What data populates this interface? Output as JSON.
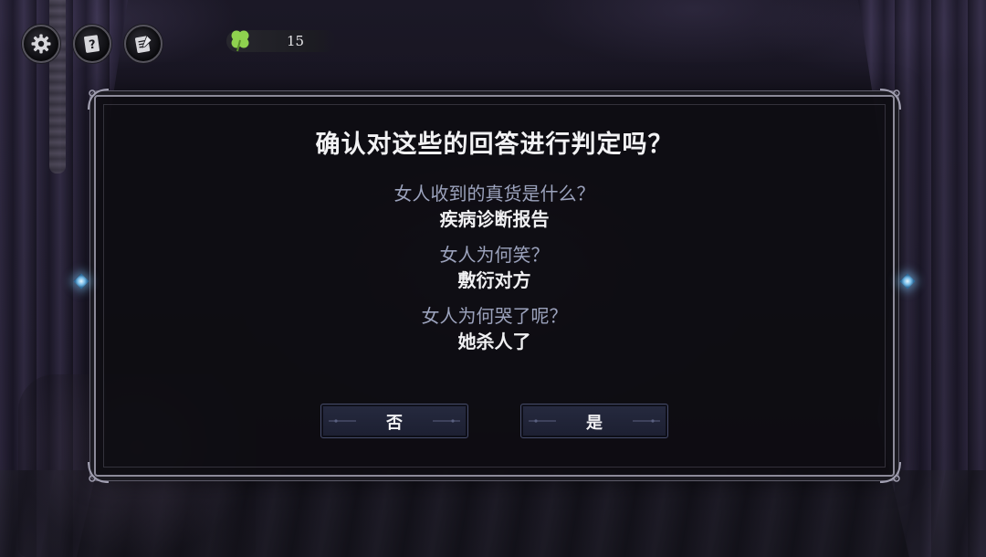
{
  "hud": {
    "settings_icon": "gear-icon",
    "help_icon": "question-card-icon",
    "notes_icon": "notebook-icon",
    "clover_icon": "four-leaf-clover-icon",
    "clover_count": "15",
    "clover_color": "#8fd14f"
  },
  "dialog": {
    "title": "确认对这些的回答进行判定吗？",
    "items": [
      {
        "question": "女人收到的真货是什么？",
        "answer": "疾病诊断报告"
      },
      {
        "question": "女人为何笑？",
        "answer": "敷衍对方"
      },
      {
        "question": "女人为何哭了呢？",
        "answer": "她杀人了"
      }
    ],
    "no_label": "否",
    "yes_label": "是",
    "accent_color": "#79bde8"
  }
}
